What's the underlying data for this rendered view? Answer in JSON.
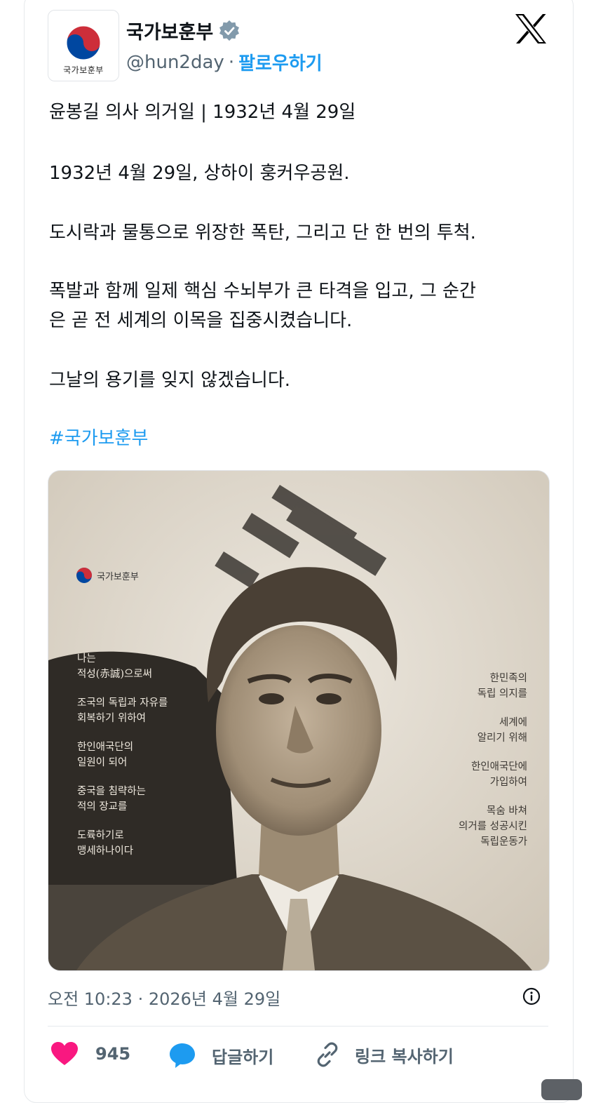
{
  "account": {
    "name": "국가보훈부",
    "handle": "@hun2day",
    "separator": "·",
    "follow_label": "팔로우하기",
    "avatar_label": "국가보훈부"
  },
  "post": {
    "paragraphs": [
      "윤봉길 의사 의거일 | 1932년 4월 29일",
      "1932년 4월 29일, 상하이 훙커우공원.",
      "도시락과 물통으로 위장한 폭탄, 그리고 단 한 번의 투척.",
      "폭발과 함께 일제 핵심 수뇌부가 큰 타격을 입고, 그 순간",
      "은 곧 전 세계의 이목을 집중시켰습니다.",
      "그날의 용기를 잊지 않겠습니다."
    ],
    "hashtag": "#국가보훈부"
  },
  "poster": {
    "logo_text": "국가보훈부",
    "left_poem": [
      [
        "나는",
        "적성(赤誠)으로써"
      ],
      [
        "조국의 독립과 자유를",
        "회복하기 위하여"
      ],
      [
        "한인애국단의",
        "일원이 되어"
      ],
      [
        "중국을 침략하는",
        "적의 장교를"
      ],
      [
        "도륙하기로",
        "맹세하나이다"
      ]
    ],
    "right_poem": [
      [
        "한민족의",
        "독립 의지를"
      ],
      [
        "세계에",
        "알리기 위해"
      ],
      [
        "한인애국단에",
        "가입하여"
      ],
      [
        "목숨 바쳐",
        "의거를 성공시킨",
        "독립운동가"
      ]
    ]
  },
  "meta": {
    "timestamp": "오전 10:23 · 2026년 4월 29일"
  },
  "actions": {
    "like_count": "945",
    "reply_label": "답글하기",
    "copy_link_label": "링크 복사하기"
  },
  "colors": {
    "accent": "#1d9bf0",
    "like": "#f91880",
    "muted": "#536471"
  }
}
